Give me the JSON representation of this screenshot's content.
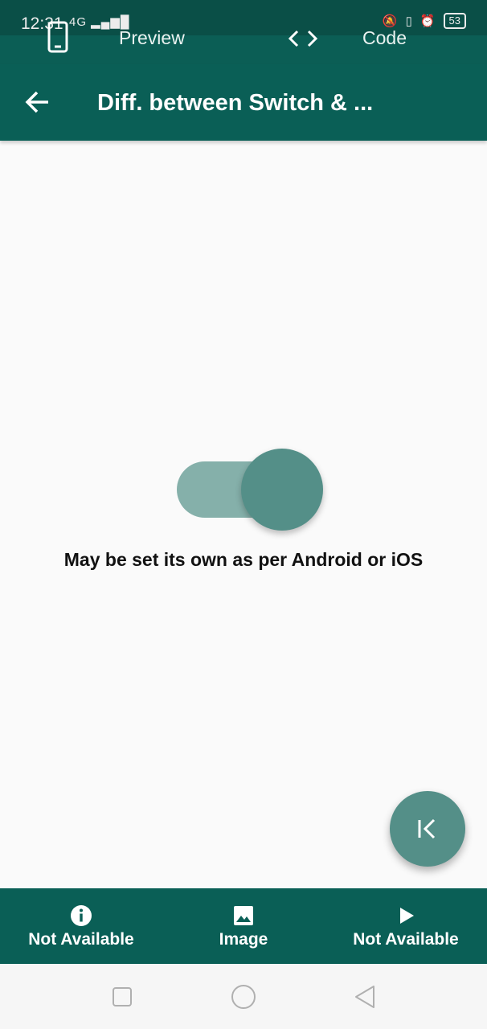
{
  "status_bar": {
    "time": "12:31",
    "network": "4G",
    "battery": "53"
  },
  "tabs": {
    "preview_label": "Preview",
    "code_label": "Code"
  },
  "app_bar": {
    "title": "Diff. between Switch & ..."
  },
  "switch": {
    "on": true,
    "caption": "May be set its own as per Android or iOS"
  },
  "bottom_nav": {
    "items": [
      {
        "label": "Not Available",
        "icon": "info-icon"
      },
      {
        "label": "Image",
        "icon": "image-icon"
      },
      {
        "label": "Not Available",
        "icon": "play-icon"
      }
    ]
  },
  "colors": {
    "primary": "#0a5f56",
    "status_bar": "#0a4f47",
    "switch_thumb": "#548f88",
    "switch_track": "#85b0aa"
  }
}
